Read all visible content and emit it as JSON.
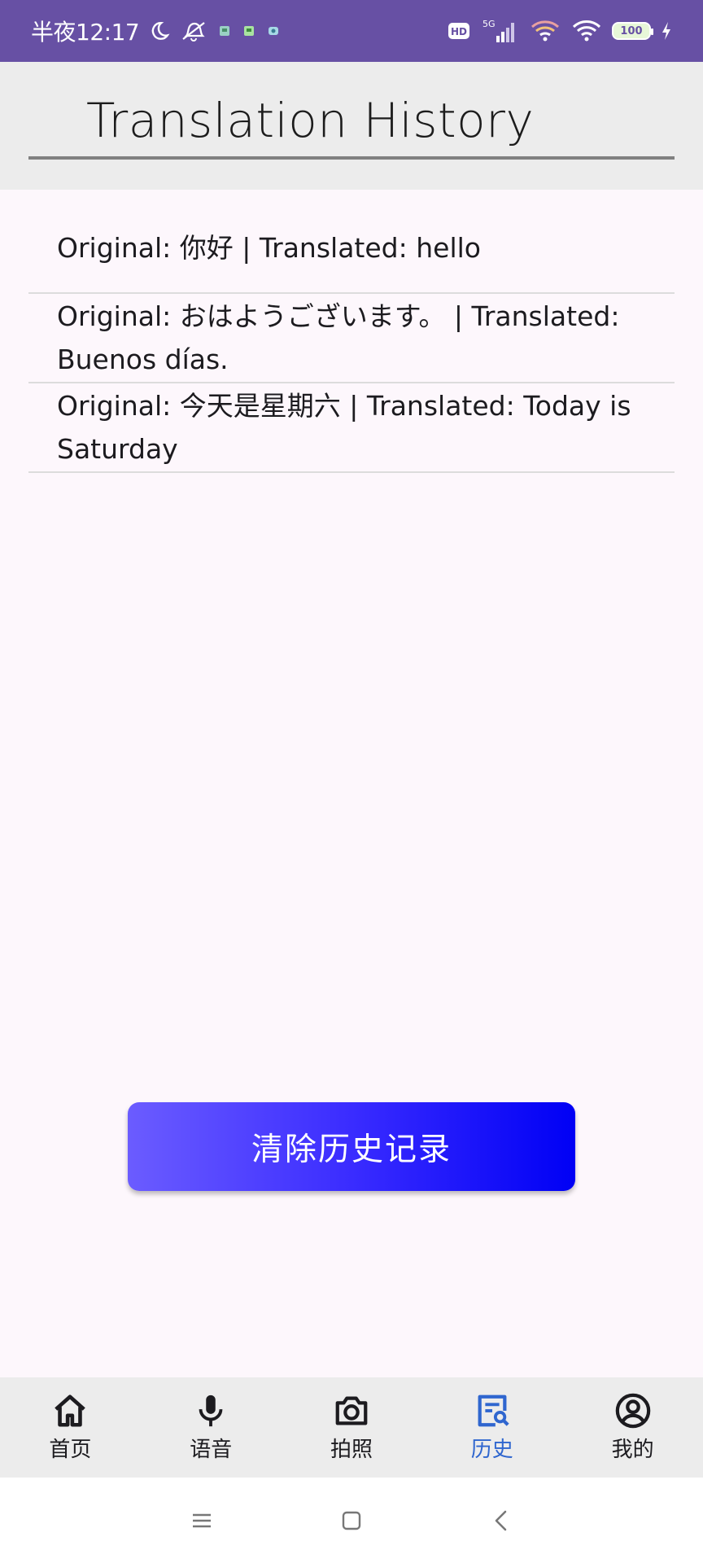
{
  "status_bar": {
    "time": "半夜12:17",
    "network": "5G",
    "hd_badge": "HD",
    "battery": "100",
    "background_color": "#6750a4"
  },
  "header": {
    "title": "Translation History"
  },
  "history": [
    {
      "text": "Original: 你好 | Translated: hello"
    },
    {
      "text": "Original: おはようございます。 | Translated: Buenos días."
    },
    {
      "text": "Original: 今天是星期六 | Translated: Today is Saturday"
    }
  ],
  "clear_button": {
    "label": "清除历史记录",
    "gradient": [
      "#6b5cff",
      "#0000f5"
    ]
  },
  "bottom_nav": {
    "items": [
      {
        "label": "首页",
        "icon": "home-icon",
        "active": false
      },
      {
        "label": "语音",
        "icon": "mic-icon",
        "active": false
      },
      {
        "label": "拍照",
        "icon": "camera-icon",
        "active": false
      },
      {
        "label": "历史",
        "icon": "history-search-icon",
        "active": true
      },
      {
        "label": "我的",
        "icon": "account-circle-icon",
        "active": false
      }
    ],
    "active_color": "#2f66cf"
  },
  "system_nav": {
    "icons": [
      "menu-icon",
      "home-square-icon",
      "back-icon"
    ]
  }
}
